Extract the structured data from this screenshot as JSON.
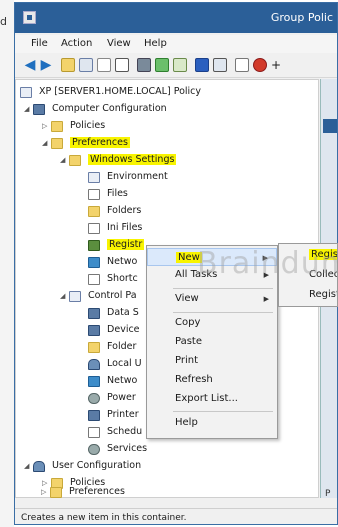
{
  "left_strip_text": "d",
  "window": {
    "title": "Group Polic"
  },
  "menu": [
    "File",
    "Action",
    "View",
    "Help"
  ],
  "tree": {
    "root": "XP [SERVER1.HOME.LOCAL] Policy",
    "computer_config": "Computer Configuration",
    "policies": "Policies",
    "preferences": "Preferences",
    "windows_settings": "Windows Settings",
    "environment": "Environment",
    "files": "Files",
    "folders": "Folders",
    "ini_files": "Ini Files",
    "registry": "Registr",
    "network": "Netwo",
    "shortcuts": "Shortc",
    "control_panel": "Control Pa",
    "data_sources": "Data S",
    "devices": "Device",
    "folder_options": "Folder",
    "local_users": "Local U",
    "network_options": "Netwo",
    "power": "Power",
    "printers": "Printer",
    "scheduled_tasks": "Schedu",
    "services": "Services",
    "user_config": "User Configuration",
    "user_policies": "Policies",
    "user_preferences": "Preferences"
  },
  "context_menu": {
    "new": "New",
    "all_tasks": "All Tasks",
    "view": "View",
    "copy": "Copy",
    "paste": "Paste",
    "print": "Print",
    "refresh": "Refresh",
    "export": "Export List...",
    "help": "Help"
  },
  "submenu": {
    "item1": "Registry Item",
    "item2": "Collection Item",
    "item3": "Registry Wizard"
  },
  "watermark": "Braindump",
  "right_pane_tab": "P",
  "status_text": "Creates a new item in this container.",
  "colors": {
    "titlebar": "#2b5f98",
    "highlight": "#f8f400",
    "menu_active": "#dbe9fb"
  }
}
